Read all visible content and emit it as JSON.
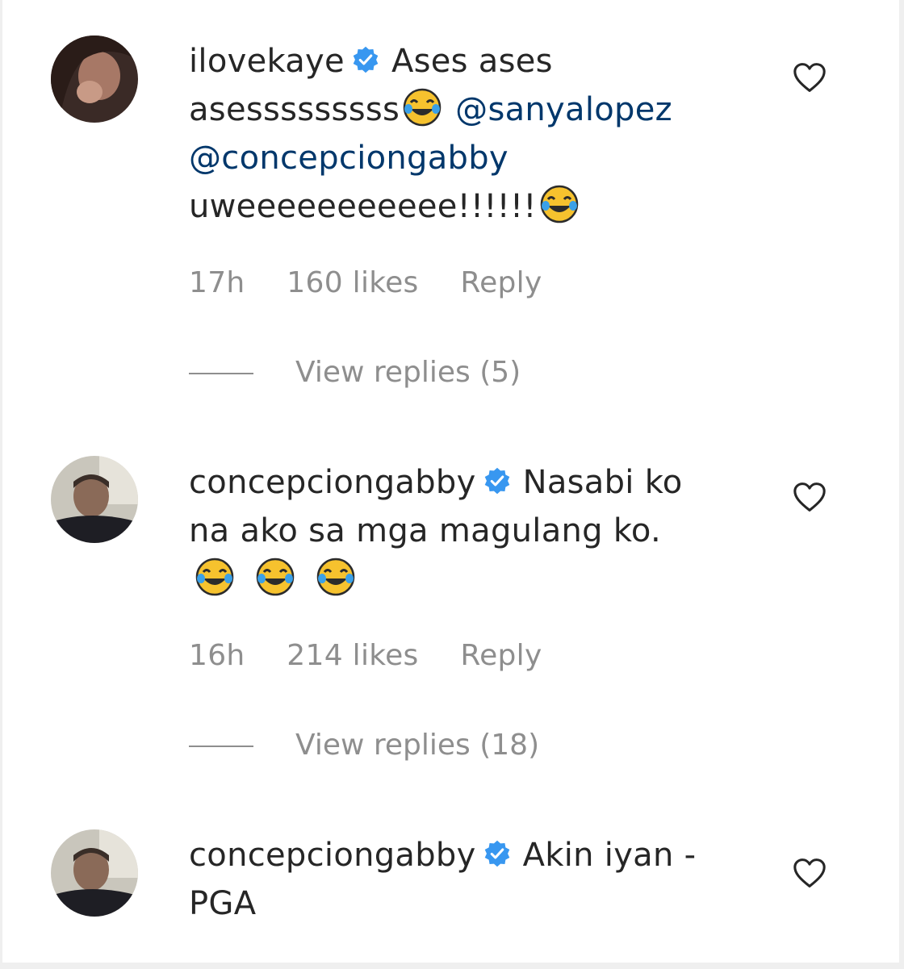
{
  "comments": [
    {
      "username": "ilovekaye",
      "avatar": "woman-avatar",
      "text_1": "Ases ases",
      "text_2": "asesssssssss",
      "mention_1": "@sanyalopez",
      "mention_2": "@concepciongabby",
      "text_3": "uweeeeeeeeeee!!!!!!",
      "emoji": "face-with-tears-of-joy",
      "time": "17h",
      "likes": "160 likes",
      "reply_label": "Reply",
      "view_replies": "View replies (5)"
    },
    {
      "username": "concepciongabby",
      "avatar": "man-avatar",
      "text_1": "Nasabi ko",
      "text_2": "na ako sa mga magulang ko.",
      "emoji": "face-with-tears-of-joy",
      "time": "16h",
      "likes": "214 likes",
      "reply_label": "Reply",
      "view_replies": "View replies (18)"
    },
    {
      "username": "concepciongabby",
      "avatar": "man-avatar",
      "text_1": "Akin iyan -",
      "text_2": "PGA"
    }
  ],
  "icons": {
    "verified": "verified-badge-icon",
    "like": "heart-outline-icon"
  },
  "colors": {
    "username": "#262626",
    "mention": "#00376b",
    "meta": "#8e8e8e",
    "verified": "#3897f0"
  }
}
